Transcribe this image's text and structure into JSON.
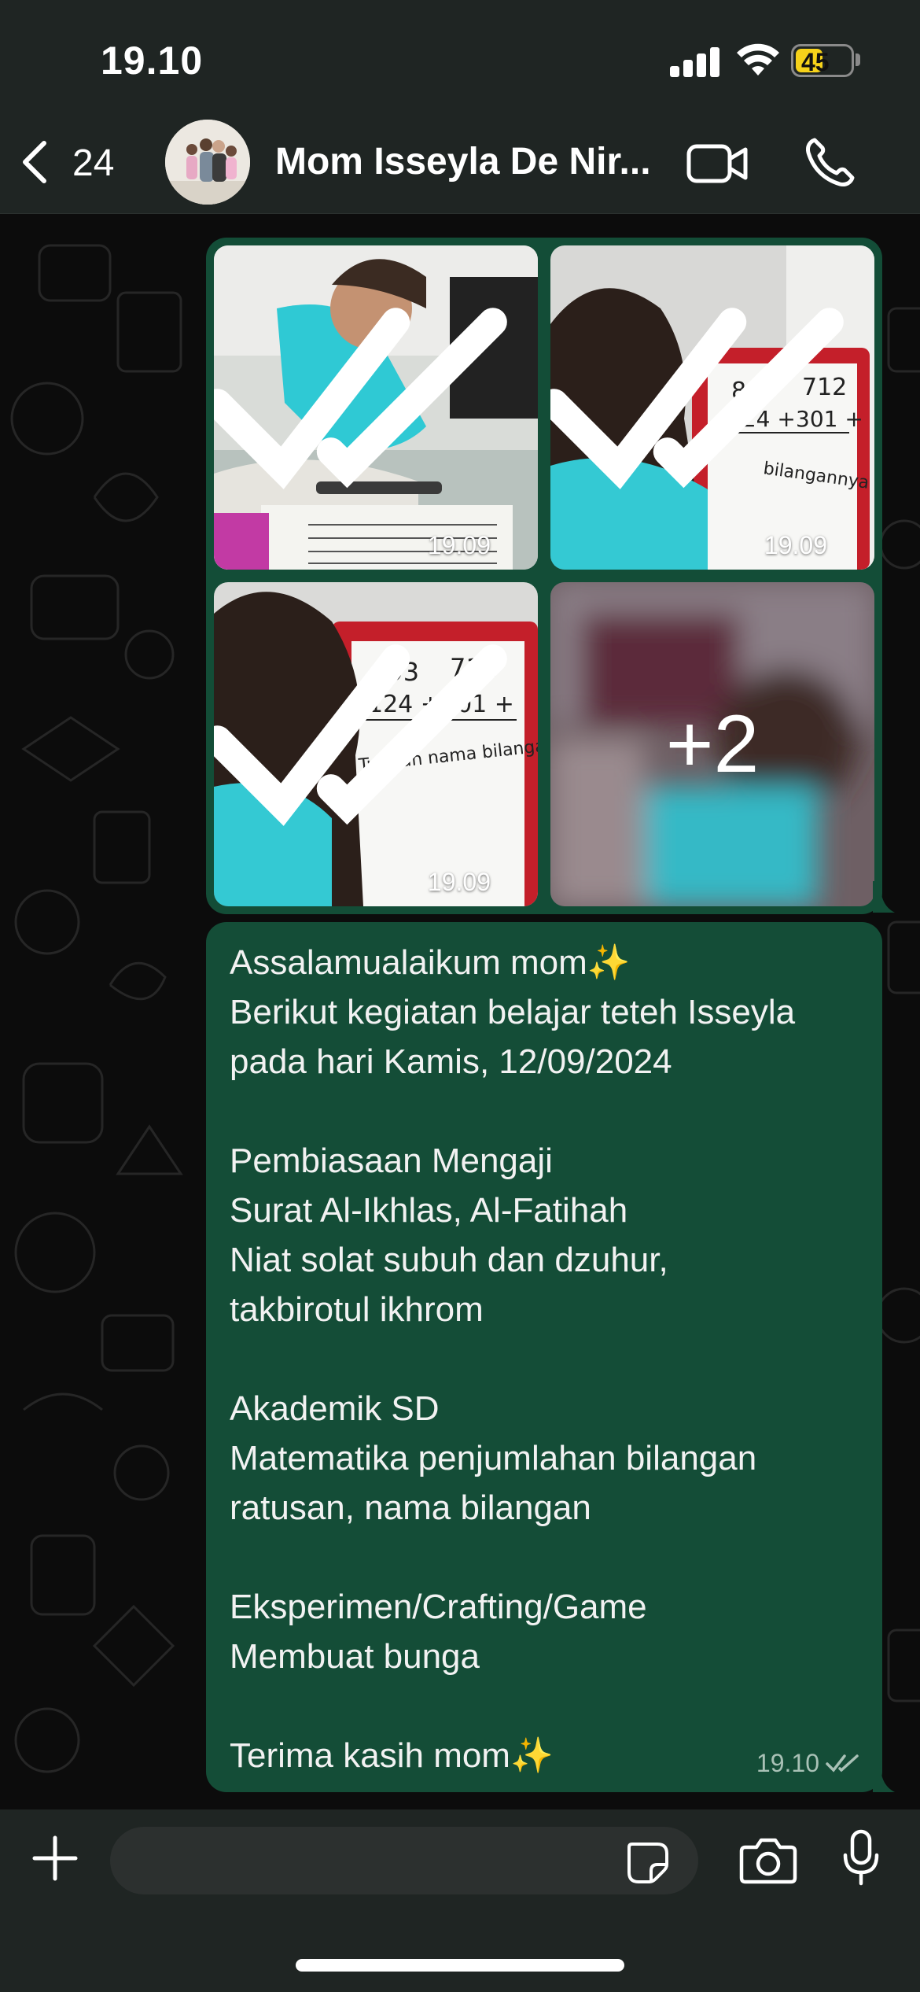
{
  "status_bar": {
    "time": "19.10",
    "battery": "45",
    "icons": [
      "signal-icon",
      "wifi-icon",
      "battery-icon"
    ]
  },
  "header": {
    "back_count": "24",
    "contact_name": "Mom Isseyla De Nir...",
    "icons": [
      "back-chevron-icon",
      "video-call-icon",
      "voice-call-icon"
    ]
  },
  "media_message": {
    "photos": [
      {
        "time": "19.09",
        "status": "read"
      },
      {
        "time": "19.09",
        "status": "read"
      },
      {
        "time": "19.09",
        "status": "read"
      },
      {
        "more_count": "+2"
      }
    ],
    "photo_board": {
      "top_left_number": "893",
      "top_right_number": "712",
      "left_addend": "124 +",
      "right_addend": "301 +",
      "instruction": "Tulislah nama bilangannya !"
    }
  },
  "text_message": {
    "text": "Assalamualaikum mom✨\nBerikut kegiatan belajar teteh Isseyla\npada hari Kamis, 12/09/2024\n\nPembiasaan Mengaji\nSurat Al-Ikhlas, Al-Fatihah\nNiat solat subuh dan dzuhur,\ntakbirotul ikhrom\n\nAkademik SD\nMatematika penjumlahan bilangan\nratusan, nama bilangan\n\nEksperimen/Crafting/Game\nMembuat bunga\n\nTerima kasih mom✨",
    "time": "19.10",
    "status": "read"
  },
  "input_bar": {
    "placeholder": "",
    "icons": [
      "plus-icon",
      "sticker-icon",
      "camera-icon",
      "microphone-icon"
    ]
  },
  "colors": {
    "header_bg": "#1f2523",
    "chat_bg": "#0c0c0c",
    "outgoing_bubble": "#134d37",
    "input_bg": "#2c302f",
    "battery_yellow": "#f6d21a"
  }
}
